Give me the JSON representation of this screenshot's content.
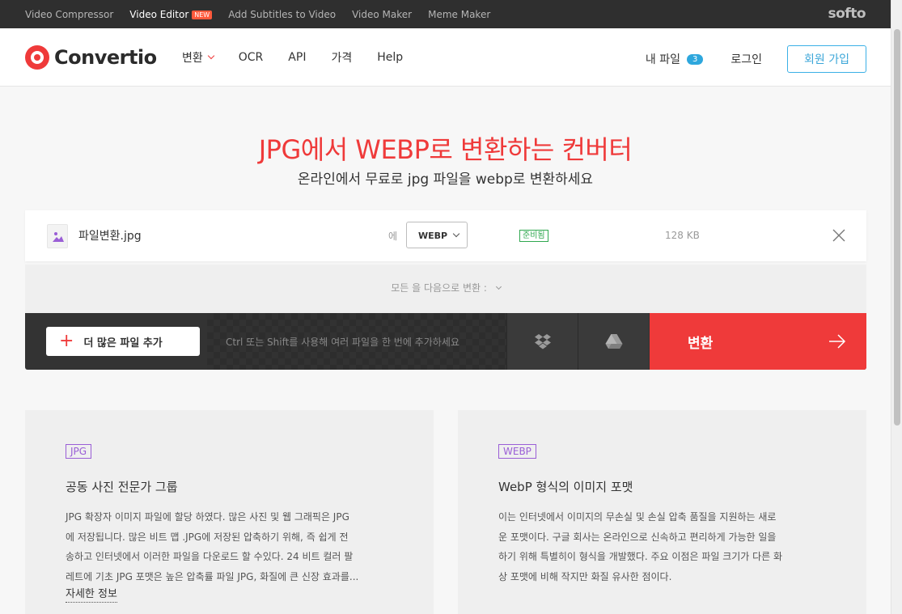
{
  "topbar": {
    "links": [
      "Video Compressor",
      "Video Editor",
      "Add Subtitles to Video",
      "Video Maker",
      "Meme Maker"
    ],
    "new_badge": "NEW",
    "brand": "softo"
  },
  "header": {
    "logo": "Convertio",
    "nav": [
      "변환",
      "OCR",
      "API",
      "가격",
      "Help"
    ],
    "my_files": "내 파일",
    "my_files_count": "3",
    "login": "로그인",
    "signup": "회원 가입"
  },
  "hero": {
    "title": "JPG에서 WEBP로 변환하는 컨버터",
    "subtitle": "온라인에서 무료로 jpg 파일을 webp로 변환하세요"
  },
  "file": {
    "name": "파일변환.jpg",
    "to_label": "에",
    "format": "WEBP",
    "status": "준비됨",
    "size": "128 KB"
  },
  "convert_all": "모든 을 다음으로 변환 :",
  "actions": {
    "add_more": "더 많은 파일 추가",
    "hint": "Ctrl 또는 Shift를 사용해 여러 파일을 한 번에 추가하세요",
    "convert": "변환"
  },
  "cards": [
    {
      "tag": "JPG",
      "title": "공동 사진 전문가 그룹",
      "body": [
        "JPG 확장자 이미지 파일에 할당 하였다. 많은 사진 및 웹 그래픽은 JPG",
        "에 저장됩니다. 많은 비트 맵 .JPG에 저장된 압축하기 위해, 즉 쉽게 전",
        "송하고 인터넷에서 이러한 파일을 다운로드 할 수있다. 24 비트 컬러 팔",
        "레트에 기초 JPG 포맷은 높은 압축률 파일 JPG, 화질에 큰 신장 효과를..."
      ],
      "more": "자세한 정보"
    },
    {
      "tag": "WEBP",
      "title": "WebP 형식의 이미지 포맷",
      "body": [
        "이는 인터넷에서 이미지의 무손실 및 손실 압축 품질을 지원하는 새로",
        "운 포맷이다. 구글 회사는 온라인으로 신속하고 편리하게 가능한 일을",
        "하기 위해 특별히이 형식을 개발했다. 주요 이점은 파일 크기가 다른 화",
        "상 포맷에 비해 작지만 화질 유사한 점이다."
      ]
    }
  ],
  "colors": {
    "accent": "#ef3a3a",
    "link_blue": "#3bb0e6",
    "tag_purple": "#9a5ed6",
    "ready_green": "#2fa84f"
  }
}
